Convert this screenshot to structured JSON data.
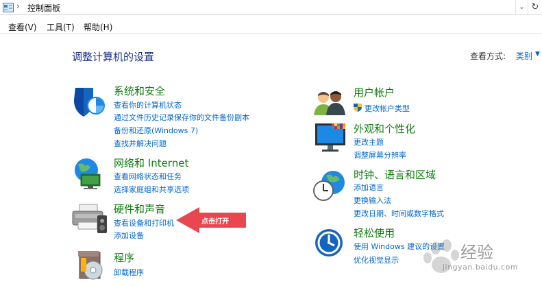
{
  "address_bar": {
    "separator": "›",
    "breadcrumb": "控制面板",
    "dropdown_glyph": "⌄",
    "refresh_glyph": "↻"
  },
  "menu": {
    "view": "查看(V)",
    "tools": "工具(T)",
    "help": "帮助(H)"
  },
  "page": {
    "heading": "调整计算机的设置",
    "view_by_label": "查看方式:",
    "view_by_value": "类别",
    "view_by_arrow": "▼"
  },
  "categories_left": [
    {
      "title": "系统和安全",
      "links": [
        "查看你的计算机状态",
        "通过文件历史记录保存你的文件备份副本",
        "备份和还原(Windows 7)",
        "查找并解决问题"
      ]
    },
    {
      "title": "网络和 Internet",
      "links": [
        "查看网络状态和任务",
        "选择家庭组和共享选项"
      ]
    },
    {
      "title": "硬件和声音",
      "links": [
        "查看设备和打印机",
        "添加设备"
      ]
    },
    {
      "title": "程序",
      "links": [
        "卸载程序"
      ]
    }
  ],
  "categories_right": [
    {
      "title": "用户帐户",
      "links": [
        "更改帐户类型"
      ]
    },
    {
      "title": "外观和个性化",
      "links": [
        "更改主题",
        "调整屏幕分辨率"
      ]
    },
    {
      "title": "时钟、语言和区域",
      "links": [
        "添加语言",
        "更换输入法",
        "更改日期、时间或数字格式"
      ]
    },
    {
      "title": "轻松使用",
      "links": [
        "使用 Windows 建议的设置",
        "优化视觉显示"
      ]
    }
  ],
  "annotation": {
    "arrow_label": "点击打开",
    "arrow_color": "#e8474f"
  },
  "watermark": {
    "text": "经验",
    "url": "jingyan.baidu.com"
  },
  "colors": {
    "link": "#0066cc",
    "category_title": "#107c10",
    "heading": "#1e3287"
  }
}
